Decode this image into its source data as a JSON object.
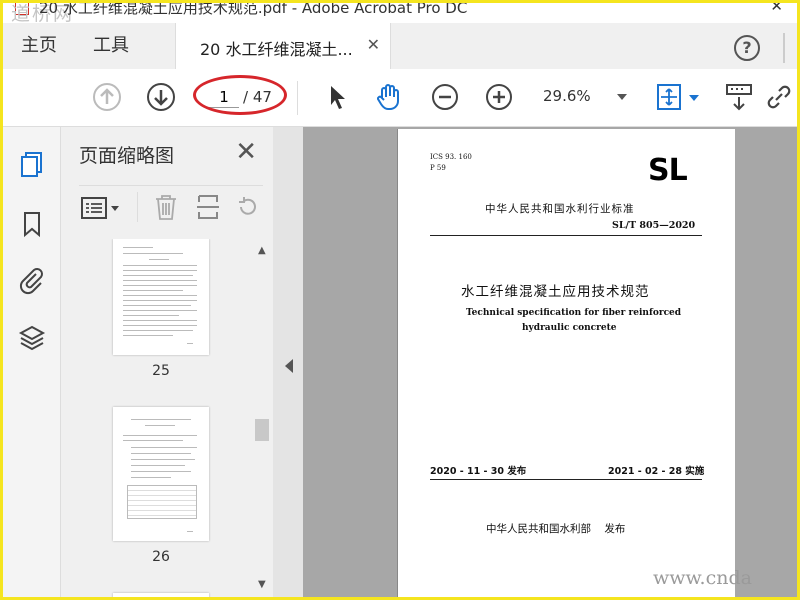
{
  "window": {
    "title": "20 水工纤维混凝土应用技术规范.pdf - Adobe Acrobat Pro DC",
    "watermark_top": "道桥网",
    "watermark_bottom": "www.cnda"
  },
  "tabs": {
    "home": "主页",
    "tools": "工具",
    "document": "20 水工纤维混凝土..."
  },
  "toolbar": {
    "page_current": "1",
    "page_total": "/ 47",
    "zoom": "29.6%"
  },
  "panel": {
    "title": "页面缩略图",
    "thumbnails": [
      {
        "label": "25"
      },
      {
        "label": "26"
      }
    ]
  },
  "document": {
    "ics": "ICS 93. 160",
    "p": "P 59",
    "logo": "SL",
    "industry_standard": "中华人民共和国水利行业标准",
    "code": "SL/T 805—2020",
    "title_cn": "水工纤维混凝土应用技术规范",
    "title_en_1": "Technical specification for fiber reinforced",
    "title_en_2": "hydraulic concrete",
    "issued": "2020 - 11 - 30 发布",
    "effective": "2021 - 02 - 28 实施",
    "publisher": "中华人民共和国水利部    发布"
  }
}
